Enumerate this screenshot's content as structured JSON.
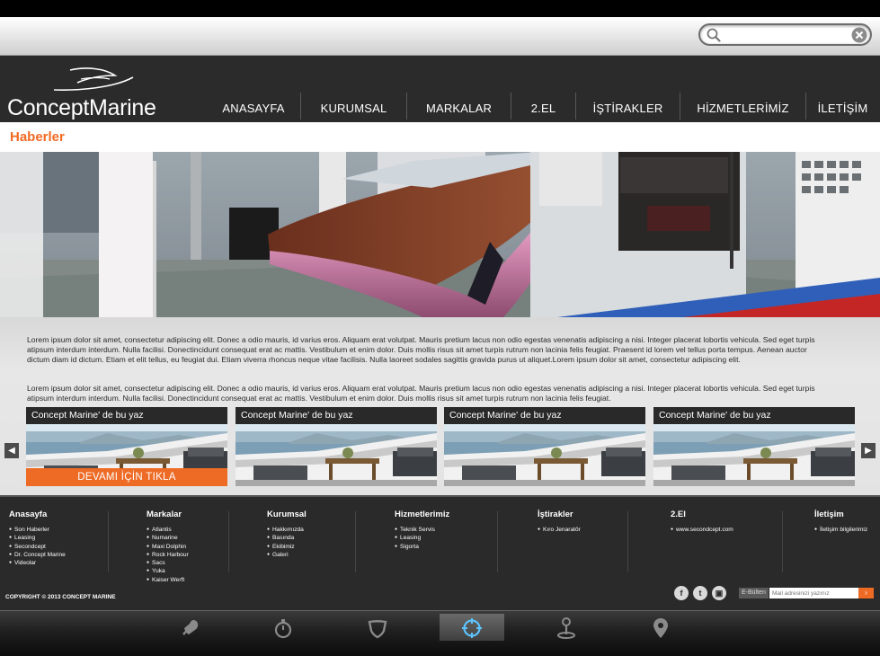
{
  "search": {
    "placeholder": "",
    "value": ""
  },
  "brand": {
    "name": "ConceptMarine"
  },
  "nav": [
    {
      "label": "ANASAYFA",
      "width": 104
    },
    {
      "label": "KURUMSAL",
      "width": 118
    },
    {
      "label": "MARKALAR",
      "width": 116
    },
    {
      "label": "2.EL",
      "width": 72
    },
    {
      "label": "İŞTİRAKLER",
      "width": 116
    },
    {
      "label": "HİZMETLERİMİZ",
      "width": 140
    },
    {
      "label": "İLETİŞİM",
      "width": 82
    }
  ],
  "page": {
    "title": "Haberler"
  },
  "article": {
    "paragraph1": "Lorem ipsum dolor sit amet, consectetur adipiscing elit. Donec a odio mauris, id varius eros. Aliquam erat volutpat. Mauris pretium lacus non odio egestas venenatis adipiscing a nisi. Integer placerat lobortis vehicula. Sed eget turpis atipsum interdum interdum. Nulla facilisi. Donectincidunt consequat erat ac mattis. Vestibulum et enim dolor. Duis mollis risus sit amet turpis rutrum non lacinia felis feugiat. Praesent id lorem vel tellus porta tempus. Aenean auctor dictum diam id dictum. Etiam et elit tellus, eu feugiat dui. Etiam viverra rhoncus neque vitae facilisis. Nulla laoreet sodales sagittis gravida purus ut aliquet.Lorem ipsum dolor sit amet, consectetur adipiscing elit.",
    "paragraph2": "Lorem ipsum dolor sit amet, consectetur adipiscing elit. Donec a odio mauris, id varius eros. Aliquam erat volutpat. Mauris pretium lacus non odio egestas venenatis adipiscing a nisi. Integer placerat lobortis vehicula. Sed eget turpis atipsum interdum interdum. Nulla facilisi. Donectincidunt consequat erat ac mattis. Vestibulum et enim dolor. Duis mollis risus sit amet turpis rutrum non lacinia felis feugiat."
  },
  "cards": [
    {
      "title": "Concept Marine' de bu yaz",
      "cta": "DEVAMI İÇİN TIKLA"
    },
    {
      "title": "Concept Marine' de bu yaz"
    },
    {
      "title": "Concept Marine' de bu yaz"
    },
    {
      "title": "Concept Marine' de bu yaz"
    }
  ],
  "footer": {
    "columns": [
      {
        "title": "Anasayfa",
        "items": [
          "Son Haberler",
          "Leasing",
          "Secondcept",
          "Dr. Concept Marine",
          "Videolar"
        ]
      },
      {
        "title": "Markalar",
        "items": [
          "Atlantis",
          "Numarine",
          "Maxi Dolphin",
          "Rock Harbour",
          "Sacs",
          "Yuka",
          "Kaiser Werft"
        ]
      },
      {
        "title": "Kurumsal",
        "items": [
          "Hakkımızda",
          "Basında",
          "Ekibimiz",
          "Galeri"
        ]
      },
      {
        "title": "Hizmetlerimiz",
        "items": [
          "Teknik Servis",
          "Leasing",
          "Sigorta"
        ]
      },
      {
        "title": "İştirakler",
        "items": [
          "Kıro Jenaratör"
        ]
      },
      {
        "title": "2.El",
        "items": [
          "www.secondcept.com"
        ]
      },
      {
        "title": "İletişim",
        "items": [
          "İletişim bilgilerimiz"
        ]
      }
    ],
    "copyright": "COPYRIGHT © 2013 CONCEPT MARINE",
    "social": [
      "facebook-icon",
      "twitter-icon",
      "instagram-icon"
    ],
    "newsletter": {
      "label": "E-Bülten",
      "placeholder": "Mail adresinizi yazınız",
      "button": "›"
    }
  },
  "dock": {
    "items": [
      "chicken-leg-icon",
      "stopwatch-icon",
      "shield-icon",
      "crosshair-icon",
      "anchor-pin-icon",
      "location-pin-icon"
    ],
    "active": "crosshair-icon"
  },
  "colors": {
    "accent": "#f26a23",
    "header": "#2c2b2b",
    "footer": "#2b2a2a"
  }
}
